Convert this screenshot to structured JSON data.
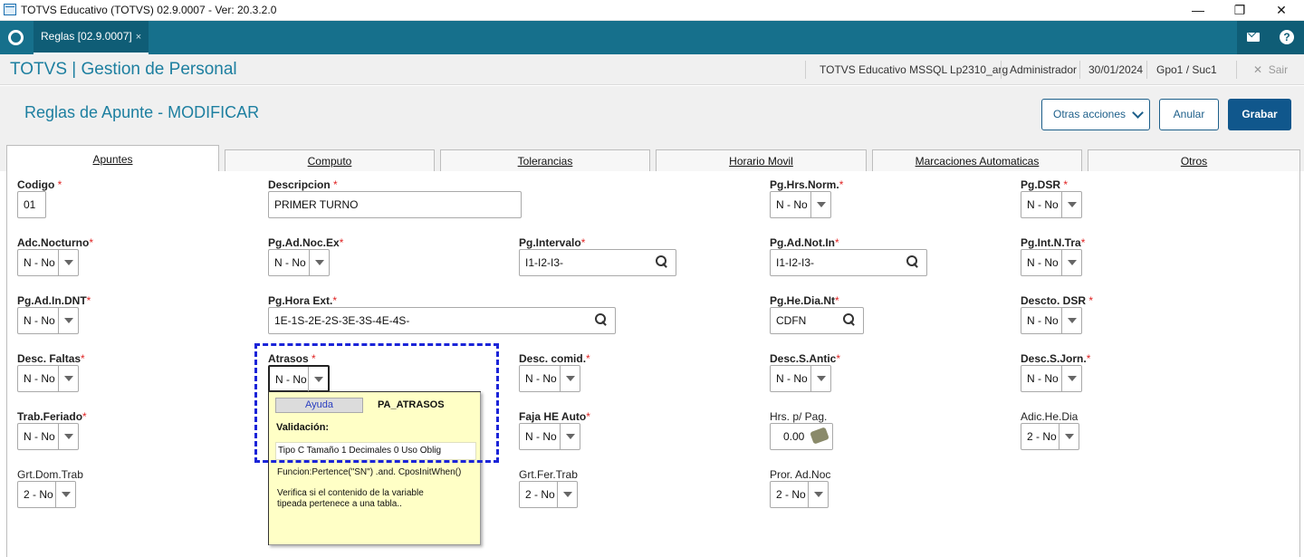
{
  "window": {
    "title": "TOTVS Educativo (TOTVS) 02.9.0007 - Ver: 20.3.2.0",
    "minimize": "—",
    "restore": "❐",
    "close": "✕"
  },
  "navbar": {
    "tab_label": "Reglas [02.9.0007]",
    "tab_close": "×",
    "help_glyph": "?"
  },
  "header": {
    "app_title": "TOTVS | Gestion de Personal",
    "environment": "TOTVS Educativo MSSQL Lp2310_arg",
    "user": "Administrador",
    "date": "30/01/2024",
    "branch": "Gpo1 / Suc1",
    "exit_label": "Sair",
    "exit_glyph": "✕"
  },
  "page": {
    "title": "Reglas de Apunte - MODIFICAR",
    "actions": {
      "other": "Otras acciones",
      "cancel": "Anular",
      "save": "Grabar"
    }
  },
  "tabs": [
    "Apuntes",
    "Computo",
    "Tolerancias",
    "Horario Movil",
    "Marcaciones Automaticas",
    "Otros"
  ],
  "form": {
    "codigo": {
      "label": "Codigo",
      "value": "01"
    },
    "descripcion": {
      "label": "Descripcion",
      "value": "PRIMER TURNO"
    },
    "pg_hrs_norm": {
      "label": "Pg.Hrs.Norm.",
      "value": "N - No"
    },
    "pg_dsr": {
      "label": "Pg.DSR",
      "value": "N - No"
    },
    "adc_nocturno": {
      "label": "Adc.Nocturno",
      "value": "N - No"
    },
    "pg_ad_noc_ex": {
      "label": "Pg.Ad.Noc.Ex",
      "value": "N - No"
    },
    "pg_intervalo": {
      "label": "Pg.Intervalo",
      "value": "I1-I2-I3-"
    },
    "pg_ad_not_in": {
      "label": "Pg.Ad.Not.In",
      "value": "I1-I2-I3-"
    },
    "pg_int_n_tra": {
      "label": "Pg.Int.N.Tra",
      "value": "N - No"
    },
    "pg_ad_in_dnt": {
      "label": "Pg.Ad.In.DNT",
      "value": "N - No"
    },
    "pg_hora_ext": {
      "label": "Pg.Hora Ext.",
      "value": "1E-1S-2E-2S-3E-3S-4E-4S-"
    },
    "pg_he_dia_nt": {
      "label": "Pg.He.Dia.Nt",
      "value": "CDFN"
    },
    "descto_dsr": {
      "label": "Descto. DSR",
      "value": "N - No"
    },
    "desc_faltas": {
      "label": "Desc. Faltas",
      "value": "N - No"
    },
    "atrasos": {
      "label": "Atrasos",
      "value": "N - No"
    },
    "desc_comid": {
      "label": "Desc. comid.",
      "value": "N - No"
    },
    "desc_s_antic": {
      "label": "Desc.S.Antic",
      "value": "N - No"
    },
    "desc_s_jorn": {
      "label": "Desc.S.Jorn.",
      "value": "N - No"
    },
    "trab_feriado": {
      "label": "Trab.Feriado",
      "value": "N - No"
    },
    "faja_he_auto": {
      "label": "Faja HE Auto",
      "value": "N - No"
    },
    "hrs_p_pag": {
      "label": "Hrs. p/ Pag.",
      "value": "0.00"
    },
    "adic_he_dia": {
      "label": "Adic.He.Dia",
      "value": "2 - No"
    },
    "grt_dom_trab": {
      "label": "Grt.Dom.Trab",
      "value": "2 - No"
    },
    "grt_fer_trab": {
      "label": "Grt.Fer.Trab",
      "value": "2 - No"
    },
    "pror_ad_noc": {
      "label": "Pror. Ad.Noc",
      "value": "2 - No"
    },
    "required_mark": "*"
  },
  "help_popup": {
    "button": "Ayuda",
    "param": "PA_ATRASOS",
    "validation_title": "Validación:",
    "validation_line": "Tipo C Tamaño   1 Decimales 0  Uso Oblig",
    "function": "Funcion:Pertence(\"SN\") .and. CposInitWhen()",
    "description": "Verifica si el contenido de la variable tipeada pertenece a una tabla.."
  },
  "colors": {
    "brand": "#16708c",
    "primary_button": "#10578c",
    "title_text": "#1d7fa0",
    "required": "#e02424",
    "popup_bg": "#ffffc6",
    "highlight": "#1a24d8"
  }
}
